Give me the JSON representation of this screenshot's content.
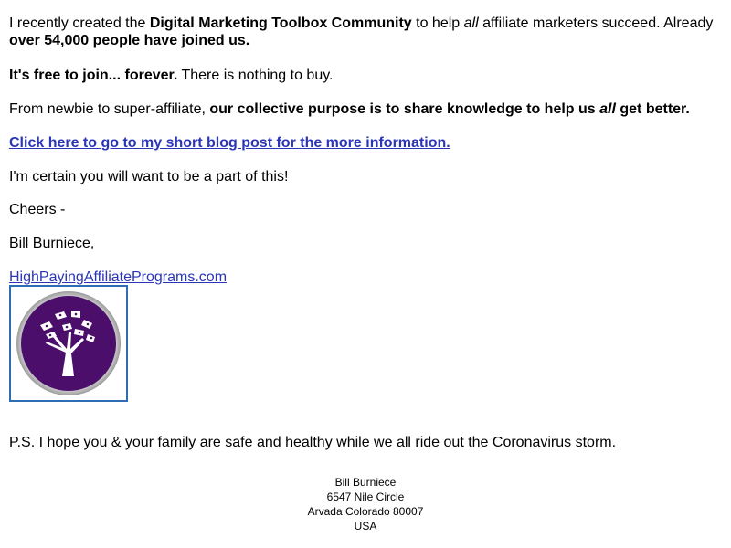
{
  "intro": {
    "t1": "I recently created the ",
    "b1": "Digital Marketing Toolbox Community",
    "t2": " to help ",
    "i1": "all",
    "t3": " affiliate marketers succeed. Already ",
    "b2": "over 54,000 people have joined us."
  },
  "free": {
    "b1": "It's free to join... forever.",
    "t1": " There is nothing to buy."
  },
  "purpose": {
    "t1": "From newbie to super-affiliate, ",
    "b1": "our collective purpose is to share knowledge to help us ",
    "bi1": "all",
    "b2": " get better."
  },
  "blog_link": "Click here to go to my short blog post for the more information.",
  "certain": "I'm certain you will want to be a part of this!",
  "cheers": "Cheers -",
  "signature_name": "Bill Burniece,",
  "site_link": "HighPayingAffiliatePrograms.com",
  "logo_icon": "tree-logo-icon",
  "ps": "P.S. I hope you & your family are safe and healthy while we all ride out the Coronavirus storm.",
  "footer": {
    "name": "Bill Burniece",
    "street": "6547 Nile Circle",
    "city": "Arvada Colorado 80007",
    "country": "USA"
  },
  "colors": {
    "link": "#2a35b8",
    "logo_purple": "#4b0f6b",
    "logo_border": "#2e6db4"
  }
}
